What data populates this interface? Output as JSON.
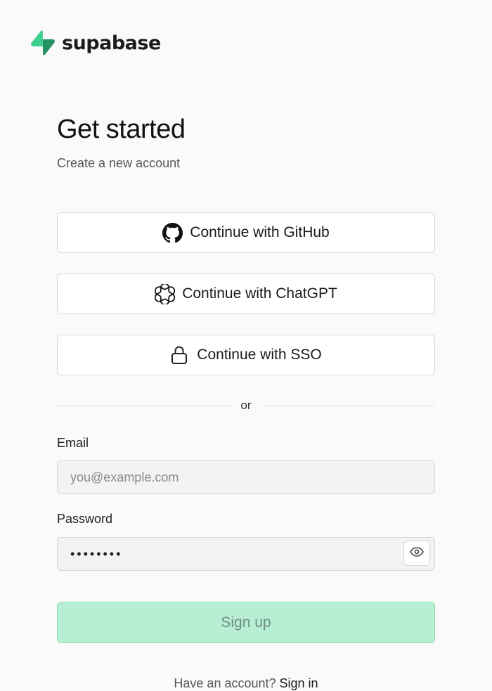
{
  "brand": {
    "name": "supabase",
    "accent_color": "#3ecf8e"
  },
  "header": {
    "title": "Get started",
    "subtitle": "Create a new account"
  },
  "auth_options": {
    "github": {
      "label": "Continue with GitHub",
      "icon": "github-icon"
    },
    "chatgpt": {
      "label": "Continue with ChatGPT",
      "icon": "openai-icon"
    },
    "sso": {
      "label": "Continue with SSO",
      "icon": "lock-icon"
    }
  },
  "divider": {
    "label": "or"
  },
  "form": {
    "email": {
      "label": "Email",
      "placeholder": "you@example.com",
      "value": ""
    },
    "password": {
      "label": "Password",
      "value": "password",
      "visibility_icon": "eye-icon"
    },
    "submit_label": "Sign up"
  },
  "footer": {
    "prompt": "Have an account?",
    "link_label": "Sign in"
  }
}
